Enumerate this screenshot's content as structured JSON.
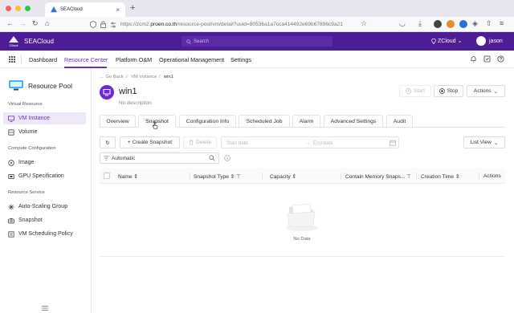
{
  "browser": {
    "tab_title": "SEACloud",
    "url_prefix": "https://zcm2.",
    "url_domain": "proen.co.th",
    "url_suffix": "/resource-pool/vm/detail?uuid=80536a1a7cca414492e69b67896c9a21"
  },
  "app": {
    "brand": "SEACloud",
    "logo_sub": "ZStack",
    "search_placeholder": "Search",
    "region": "ZCloud",
    "user": "jason",
    "accent": "#6d28d9",
    "header_bg": "#4c1d95"
  },
  "modules": [
    "Dashboard",
    "Resource Center",
    "Platform O&M",
    "Operational Management",
    "Settings"
  ],
  "sidebar": {
    "title": "Resource Pool",
    "sections": [
      {
        "label": "Virtual Resource",
        "items": [
          {
            "label": "VM Instance",
            "icon": "monitor-icon",
            "active": true
          },
          {
            "label": "Volume",
            "icon": "volume-icon"
          }
        ]
      },
      {
        "label": "Compute Configuration",
        "items": [
          {
            "label": "Image",
            "icon": "image-icon"
          },
          {
            "label": "GPU Specification",
            "icon": "gpu-icon"
          }
        ]
      },
      {
        "label": "Resource Service",
        "items": [
          {
            "label": "Auto-Scaling Group",
            "icon": "scaling-icon"
          },
          {
            "label": "Snapshot",
            "icon": "camera-icon"
          },
          {
            "label": "VM Scheduling Policy",
            "icon": "policy-icon"
          }
        ]
      }
    ]
  },
  "breadcrumb": {
    "back": "← Go Back",
    "parent": "VM Instance",
    "sep": "/",
    "current": "win1"
  },
  "vm": {
    "name": "win1",
    "description": "No description"
  },
  "actions": {
    "start": "Start",
    "stop": "Stop",
    "more": "Actions"
  },
  "tabs": [
    "Overview",
    "Snapshot",
    "Configuration Info",
    "Scheduled Job",
    "Alarm",
    "Advanced Settings",
    "Audit"
  ],
  "active_tab": "Snapshot",
  "toolbar": {
    "create": "+ Create Snapshot",
    "delete": "Delete",
    "start_date": "Start date",
    "arrow": "→",
    "end_date": "End date",
    "view": "List View"
  },
  "filter": {
    "value": "Automatic"
  },
  "table": {
    "columns": [
      "Name",
      "Snapshot Type",
      "Capacity",
      "Contain Memory Snaps...",
      "Creation Time",
      "Actions"
    ],
    "rows": [],
    "empty_text": "No Data"
  }
}
